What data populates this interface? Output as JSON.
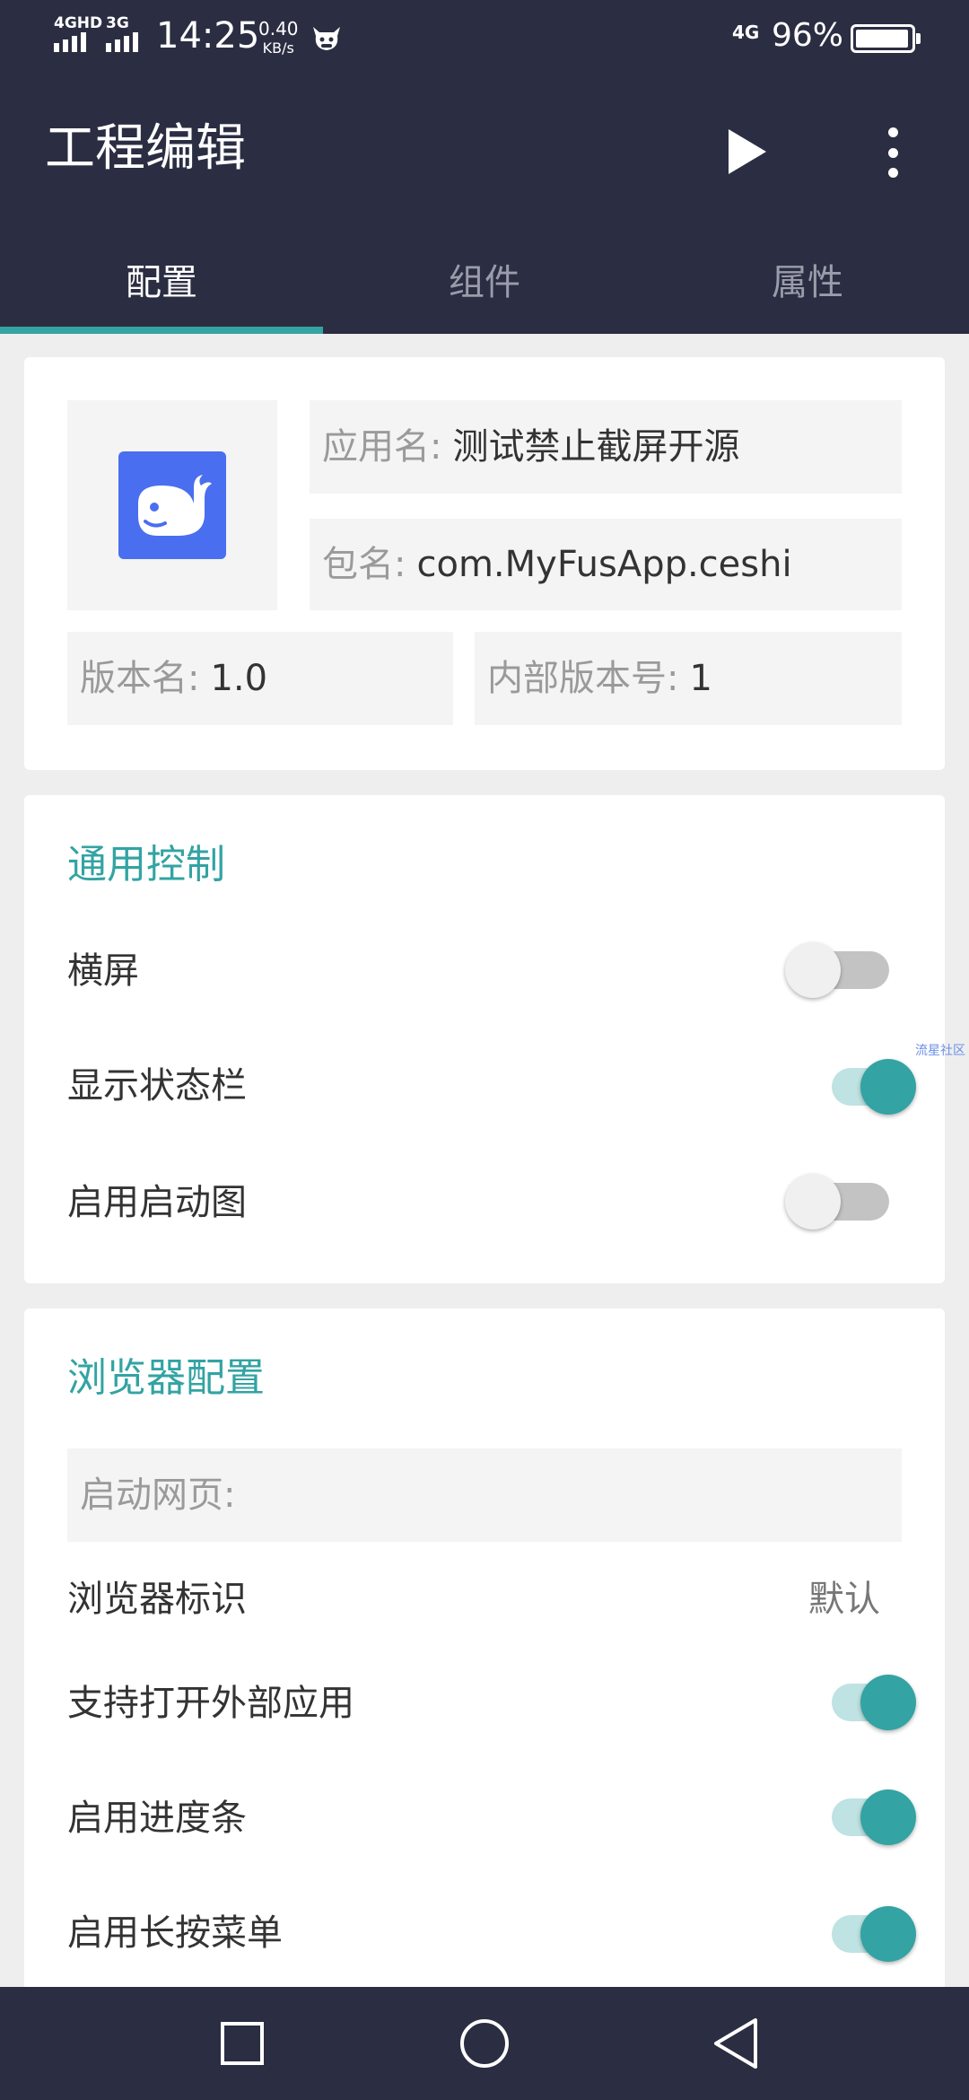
{
  "status_bar": {
    "signal1_label": "4GHD",
    "signal2_label": "3G",
    "time": "14:25",
    "net_speed_value": "0.40",
    "net_speed_unit": "KB/s",
    "network_type": "4G",
    "battery_percent": "96%",
    "battery_level": 0.96
  },
  "app_bar": {
    "title": "工程编辑",
    "icons": [
      "play-icon",
      "more-vert-icon"
    ]
  },
  "tabs": [
    {
      "label": "配置",
      "active": true
    },
    {
      "label": "组件",
      "active": false
    },
    {
      "label": "属性",
      "active": false
    }
  ],
  "app_info": {
    "app_name_label": "应用名:",
    "app_name_value": "测试禁止截屏开源",
    "package_label": "包名:",
    "package_value": "com.MyFusApp.ceshi",
    "version_name_label": "版本名:",
    "version_name_value": "1.0",
    "version_code_label": "内部版本号:",
    "version_code_value": "1"
  },
  "general": {
    "title": "通用控制",
    "items": [
      {
        "label": "横屏",
        "on": false
      },
      {
        "label": "显示状态栏",
        "on": true
      },
      {
        "label": "启用启动图",
        "on": false
      }
    ]
  },
  "browser": {
    "title": "浏览器配置",
    "start_page_label": "启动网页:",
    "start_page_value": "",
    "ua_label": "浏览器标识",
    "ua_value": "默认",
    "items": [
      {
        "label": "支持打开外部应用",
        "on": true
      },
      {
        "label": "启用进度条",
        "on": true
      },
      {
        "label": "启用长按菜单",
        "on": true
      }
    ]
  },
  "watermark": "流星社区",
  "colors": {
    "bar_bg": "#2b2e42",
    "accent": "#33a3a3",
    "app_icon_bg": "#4a6ef0"
  },
  "nav_bar": {
    "buttons": [
      "recents-square-icon",
      "home-circle-icon",
      "back-triangle-icon"
    ]
  }
}
